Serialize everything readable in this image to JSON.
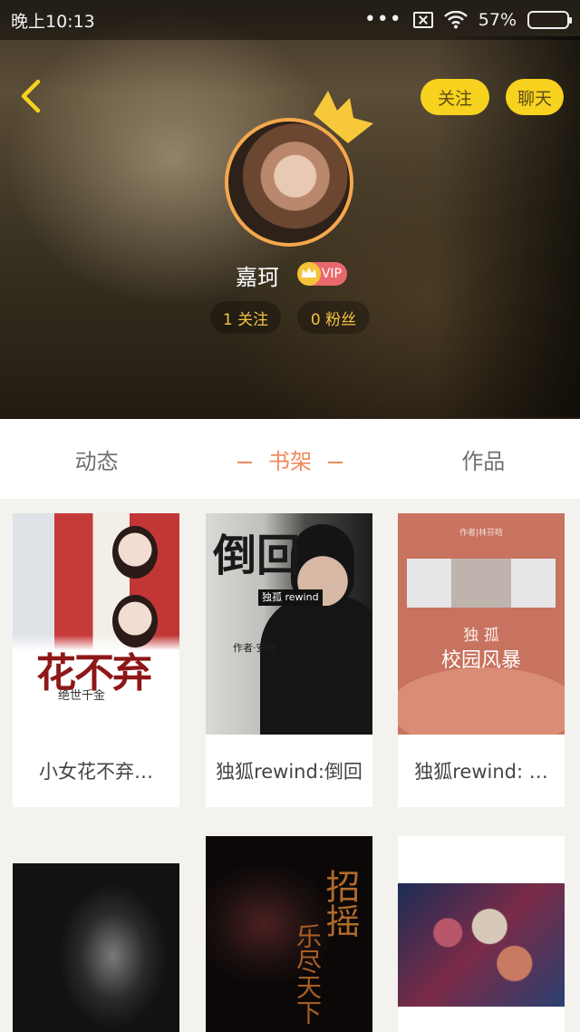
{
  "status_bar": {
    "time": "晚上10:13",
    "battery_text": "57%",
    "battery_level": 0.57
  },
  "header": {
    "follow_button": "关注",
    "chat_button": "聊天",
    "username": "嘉珂",
    "vip_label": "VIP",
    "following_stat": "1 关注",
    "fans_stat": "0 粉丝",
    "accent_color": "#f7d21e",
    "avatar_ring_color": "#f5a84c"
  },
  "tabs": [
    {
      "label": "动态",
      "active": false
    },
    {
      "label": "书架",
      "active": true
    },
    {
      "label": "作品",
      "active": false
    }
  ],
  "books": [
    {
      "title": "小女花不弃…",
      "cover_title": "花不弃",
      "cover_subtitle": "绝世千金"
    },
    {
      "title": "独狐rewind:倒回",
      "cover_title": "倒回",
      "cover_tag": "独孤 rewind",
      "cover_author": "作者·安昉"
    },
    {
      "title": "独狐rewind: …",
      "cover_top": "作者|林芬晗",
      "cover_line1": "独 孤",
      "cover_line2": "校园风暴"
    },
    {
      "title": ""
    },
    {
      "title": "",
      "cover_title": "招摇",
      "cover_subtitle": "乐尽天下"
    },
    {
      "title": ""
    }
  ]
}
